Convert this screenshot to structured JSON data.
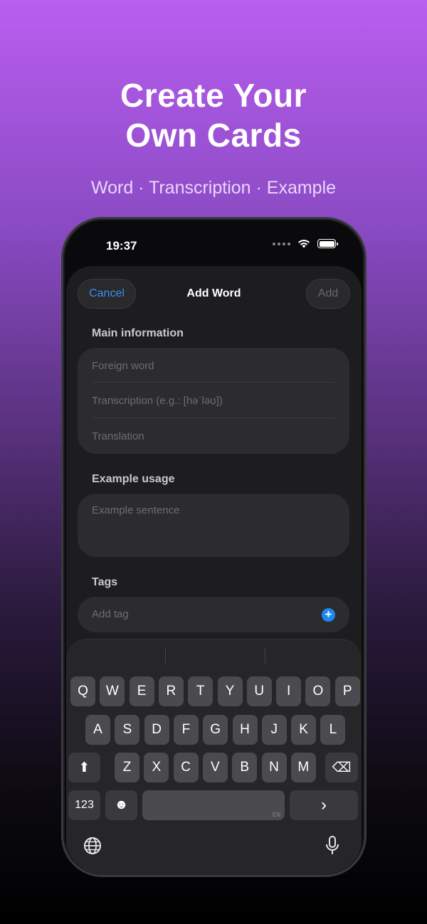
{
  "promo": {
    "title_line1": "Create Your",
    "title_line2": "Own Cards",
    "subtitle": "Word · Transcription · Example"
  },
  "status_bar": {
    "time": "19:37"
  },
  "sheet": {
    "cancel_label": "Cancel",
    "title": "Add Word",
    "add_label": "Add"
  },
  "main_info": {
    "label": "Main information",
    "foreign_word_placeholder": "Foreign word",
    "transcription_placeholder": "Transcription (e.g.: [həˈləʊ])",
    "translation_placeholder": "Translation"
  },
  "example": {
    "label": "Example usage",
    "sentence_placeholder": "Example sentence"
  },
  "tags": {
    "label": "Tags",
    "add_placeholder": "Add tag",
    "add_icon": "+"
  },
  "keyboard": {
    "row1": [
      "Q",
      "W",
      "E",
      "R",
      "T",
      "Y",
      "U",
      "I",
      "O",
      "P"
    ],
    "row2": [
      "A",
      "S",
      "D",
      "F",
      "G",
      "H",
      "J",
      "K",
      "L"
    ],
    "row3": [
      "Z",
      "X",
      "C",
      "V",
      "B",
      "N",
      "M"
    ],
    "numbers_key": "123",
    "emoji_key": "☻",
    "shift_icon": "⬆",
    "delete_icon": "⌫",
    "space_lang": "EN",
    "return_glyph": "›",
    "globe_icon": "globe-icon",
    "mic_icon": "microphone-icon"
  },
  "colors": {
    "accent": "#3a8ef0",
    "plus": "#1e88f2",
    "sheet_bg": "#1d1d20"
  }
}
